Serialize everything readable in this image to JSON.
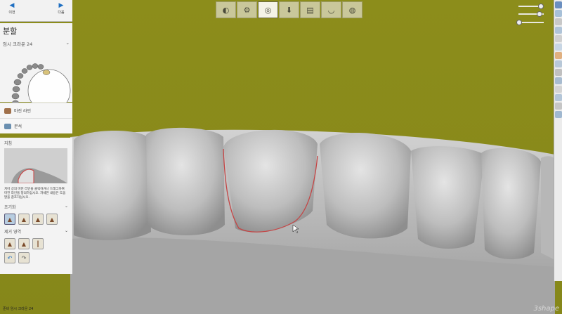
{
  "toolbar": {
    "back_label": "이전",
    "next_label": "다음",
    "steps": [
      "scan-icon",
      "align-icon",
      "segment-icon",
      "export-icon",
      "design-icon",
      "crown-icon",
      "finish-icon"
    ]
  },
  "panel": {
    "title": "분할",
    "tooth_label": "임시 크라운 24",
    "items": [
      {
        "label": "마진 라인",
        "icon": "margin-line-icon"
      },
      {
        "label": "분석",
        "icon": "analysis-icon"
      }
    ],
    "guide": {
      "title": "지침",
      "text": "치아 상의 마진 라인을 클릭하거나 드래그하여 마진 라인을 정의하십시오. 자세한 내용은 도움말을 참조하십시오."
    },
    "sections": [
      {
        "label": "초기화",
        "tools": 4
      },
      {
        "label": "제거 영역",
        "tools": 5
      }
    ]
  },
  "status": {
    "text": "준비   임시 크라운 24"
  },
  "logo": "3shape"
}
